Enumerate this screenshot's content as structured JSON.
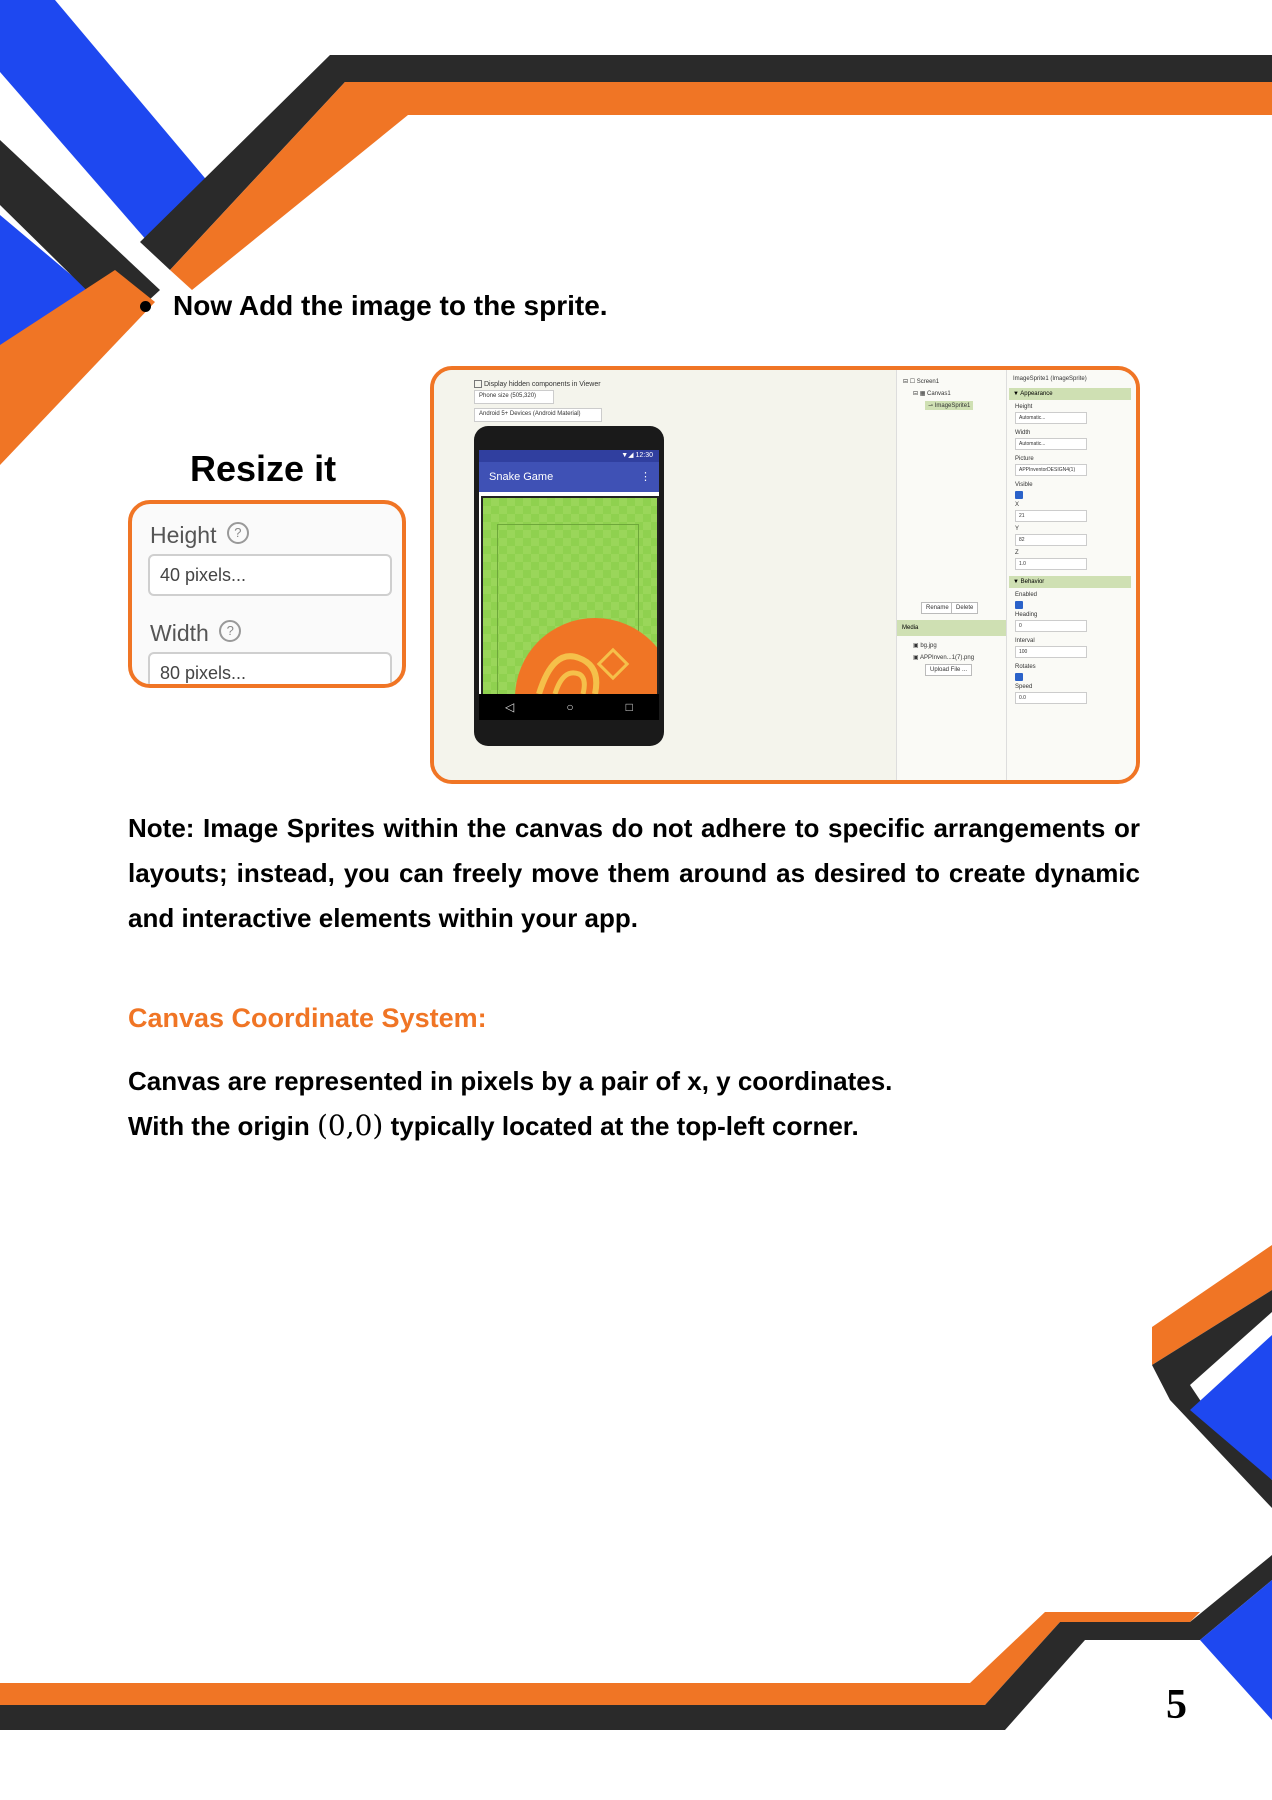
{
  "colors": {
    "accent_orange": "#F07525",
    "accent_blue": "#1E48F0",
    "dark": "#2A2A2A"
  },
  "bullet": {
    "text": "Now Add the image to the sprite."
  },
  "resize": {
    "title": "Resize it",
    "height_label": "Height",
    "height_value": "40 pixels...",
    "width_label": "Width",
    "width_value": "80 pixels...",
    "help_icon": "?"
  },
  "designer": {
    "viewer": {
      "hidden_components_option": "Display hidden components in Viewer",
      "phone_size": "Phone size (505,320)",
      "theme": "Android 5+ Devices (Android Material)",
      "status_time": "12:30",
      "app_title": "Snake Game",
      "nav_icons": [
        "◁",
        "○",
        "□"
      ]
    },
    "components": {
      "items": [
        "Screen1",
        "Canvas1",
        "ImageSprite1"
      ],
      "rename_label": "Rename",
      "delete_label": "Delete",
      "media_title": "Media",
      "media_files": [
        "bg.jpg",
        "APPInven...1(7).png"
      ],
      "upload_label": "Upload File ..."
    },
    "properties": {
      "title": "ImageSprite1 (ImageSprite)",
      "appearance_label": "Appearance",
      "behavior_label": "Behavior",
      "height_label": "Height",
      "height_value": "Automatic...",
      "width_label": "Width",
      "width_value": "Automatic...",
      "picture_label": "Picture",
      "picture_value": "APPInventorDESIGN4(1)",
      "visible_label": "Visible",
      "x_label": "X",
      "x_value": "21",
      "y_label": "Y",
      "y_value": "82",
      "z_label": "Z",
      "z_value": "1.0",
      "enabled_label": "Enabled",
      "heading_label": "Heading",
      "heading_value": "0",
      "interval_label": "Interval",
      "interval_value": "100",
      "rotates_label": "Rotates",
      "speed_label": "Speed",
      "speed_value": "0.0"
    }
  },
  "note": {
    "text": "Note: Image Sprites within the canvas do not adhere to specific arrangements or layouts; instead, you can freely move them around as desired to create dynamic and interactive elements within your app."
  },
  "canvas_section": {
    "title": "Canvas Coordinate System:",
    "line1": "Canvas are represented in pixels by a pair of x, y coordinates.",
    "line2_before": "With the origin",
    "line2_origin": "(0,0)",
    "line2_after": "typically located at the top-left corner."
  },
  "page_number": "5"
}
